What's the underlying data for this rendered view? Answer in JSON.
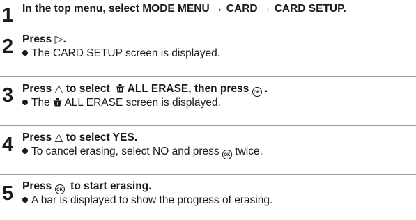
{
  "steps": [
    {
      "number": "1",
      "parts": [
        "In the top menu, select MODE MENU ",
        "→",
        " CARD ",
        "→",
        " CARD SETUP."
      ]
    },
    {
      "number": "2",
      "title_a": "Press ",
      "right_icon": "▷",
      "title_b": ".",
      "note": "The CARD SETUP screen is displayed."
    },
    {
      "number": "3",
      "title_a": "Press ",
      "up_icon": "△",
      "title_b": " to select ",
      "erase_icon": "erase-all-icon",
      "title_c": " ALL ERASE, then press ",
      "ok_icon": "OK",
      "title_d": " .",
      "note_a": "The ",
      "note_b": " ALL ERASE screen is displayed."
    },
    {
      "number": "4",
      "title_a": "Press ",
      "up_icon": "△",
      "title_b": " to select YES.",
      "note_a": "To cancel erasing, select NO  and press ",
      "ok_icon": "OK",
      "note_b": " twice."
    },
    {
      "number": "5",
      "title_a": "Press ",
      "ok_icon": "OK",
      "title_b": "  to start erasing.",
      "note": "A bar is displayed to show the progress of erasing."
    }
  ]
}
